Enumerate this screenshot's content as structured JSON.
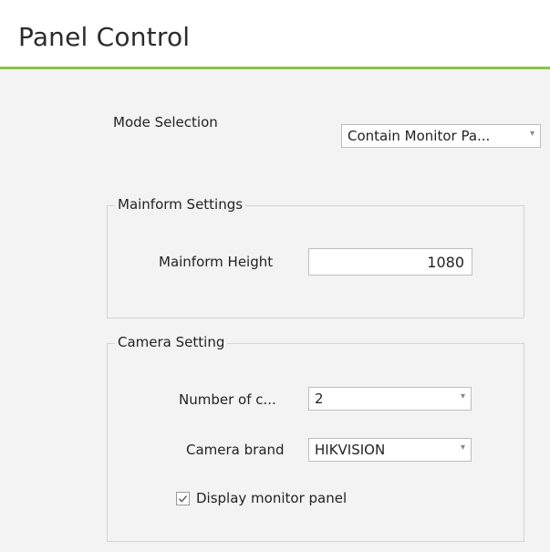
{
  "header": {
    "title": "Panel Control",
    "accent_color": "#8cc34a"
  },
  "mode_selection": {
    "label": "Mode Selection",
    "value": "Contain Monitor Pa...",
    "arrow_icon": "chevron-down-icon"
  },
  "mainform_settings": {
    "group_title": "Mainform Settings",
    "height_label": "Mainform Height",
    "height_value": "1080"
  },
  "camera_setting": {
    "group_title": "Camera Setting",
    "number_label": "Number of c...",
    "number_value": "2",
    "brand_label": "Camera brand",
    "brand_value": "HIKVISION",
    "display_checkbox": {
      "label": "Display monitor panel",
      "checked": true
    }
  }
}
